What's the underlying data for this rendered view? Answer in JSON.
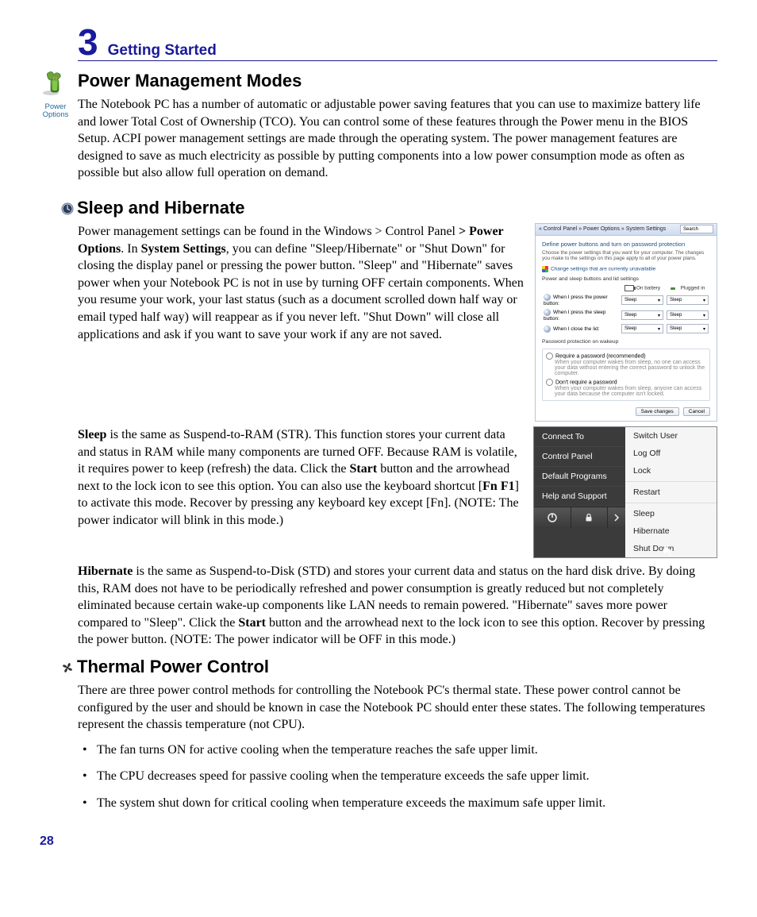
{
  "chapter": {
    "number": "3",
    "title": "Getting Started"
  },
  "page_number": "28",
  "sections": {
    "power_mgmt": {
      "icon_label": "Power\nOptions",
      "heading": "Power Management Modes",
      "para": "The Notebook PC has a number of automatic or adjustable power saving features that you can use to maximize battery life and lower Total Cost of Ownership (TCO). You can control some of these features through the Power menu in the BIOS Setup. ACPI power management settings are made through the operating system. The power management features are designed to save as much electricity as possible by putting components into a low power consumption mode as often as possible but also allow full operation on demand."
    },
    "sleep": {
      "heading": "Sleep and Hibernate",
      "para1_pre": "Power management settings can be found in the Windows > Control Panel ",
      "para1_b1": "> Power Options",
      "para1_mid1": ". In ",
      "para1_b2": "System Settings",
      "para1_post": ", you can define \"Sleep/Hibernate\" or \"Shut Down\" for closing the display panel or pressing the power button. \"Sleep\" and \"Hibernate\" saves power when your Notebook PC is not in use by turning OFF certain components. When you resume your work, your last status (such as a document scrolled down half way or email typed half way) will reappear as if you never left. \"Shut Down\" will close all applications and ask if you want to save your work if any are not saved.",
      "para2_b1": "Sleep",
      "para2_seg1": " is the same as Suspend-to-RAM (STR). This function stores your current data and status in RAM while many components are turned OFF. Because RAM is volatile, it requires power to keep (refresh) the data. Click the ",
      "para2_b2": "Start",
      "para2_seg2": " button and the arrowhead next to the lock icon to see this option. You can also use the keyboard shortcut [",
      "para2_b3": "Fn F1",
      "para2_seg3": "] to activate this mode. Recover by pressing any keyboard key except [Fn]. (NOTE: The power indicator will blink in this mode.)",
      "para3_b1": "Hibernate",
      "para3_seg1": " is the same as  Suspend-to-Disk (STD) and stores your current data and status on the hard disk drive. By doing this, RAM does not have to be periodically refreshed and power consumption is greatly reduced but not completely eliminated because certain wake-up components like LAN needs to remain powered. \"Hibernate\" saves more power compared to \"Sleep\". Click the ",
      "para3_b2": "Start",
      "para3_seg2": " button and the arrowhead next to the lock icon to see this option. Recover by pressing the power button. (NOTE: The power indicator will be OFF in this mode.)"
    },
    "thermal": {
      "heading": "Thermal Power Control",
      "intro": "There are three power control methods for controlling the Notebook PC's thermal state. These power control cannot be configured by the user and should be known in case the Notebook PC should enter these states. The following temperatures represent the chassis temperature (not CPU).",
      "bullets": [
        "The fan turns ON for active cooling when the temperature reaches the safe upper limit.",
        "The CPU decreases speed for passive cooling when the temperature exceeds the safe upper limit.",
        "The system shut down for critical cooling when temperature exceeds the maximum safe upper limit."
      ]
    }
  },
  "settings_window": {
    "breadcrumb": "« Control Panel » Power Options » System Settings",
    "search": "Search",
    "lead": "Define power buttons and turn on password protection",
    "sub": "Choose the power settings that you want for your computer. The changes you make to the settings on this page apply to all of your power plans.",
    "change_link": "Change settings that are currently unavailable",
    "group1": "Power and sleep buttons and lid settings",
    "col_battery": "On battery",
    "col_plugged": "Plugged in",
    "rows": [
      {
        "label": "When I press the power button:",
        "val": "Sleep"
      },
      {
        "label": "When I press the sleep button:",
        "val": "Sleep"
      },
      {
        "label": "When I close the lid:",
        "val": "Sleep"
      }
    ],
    "group2": "Password protection on wakeup",
    "opt1": "Require a password (recommended)",
    "opt1_desc": "When your computer wakes from sleep, no one can access your data without entering the correct password to unlock the computer.",
    "opt2": "Don't require a password",
    "opt2_desc": "When your computer wakes from sleep, anyone can access your data because the computer isn't locked.",
    "btn_save": "Save changes",
    "btn_cancel": "Cancel"
  },
  "start_menu": {
    "left": [
      "Connect To",
      "Control Panel",
      "Default Programs",
      "Help and Support"
    ],
    "right": [
      "Switch User",
      "Log Off",
      "Lock",
      "Restart",
      "Sleep",
      "Hibernate",
      "Shut Down"
    ]
  }
}
